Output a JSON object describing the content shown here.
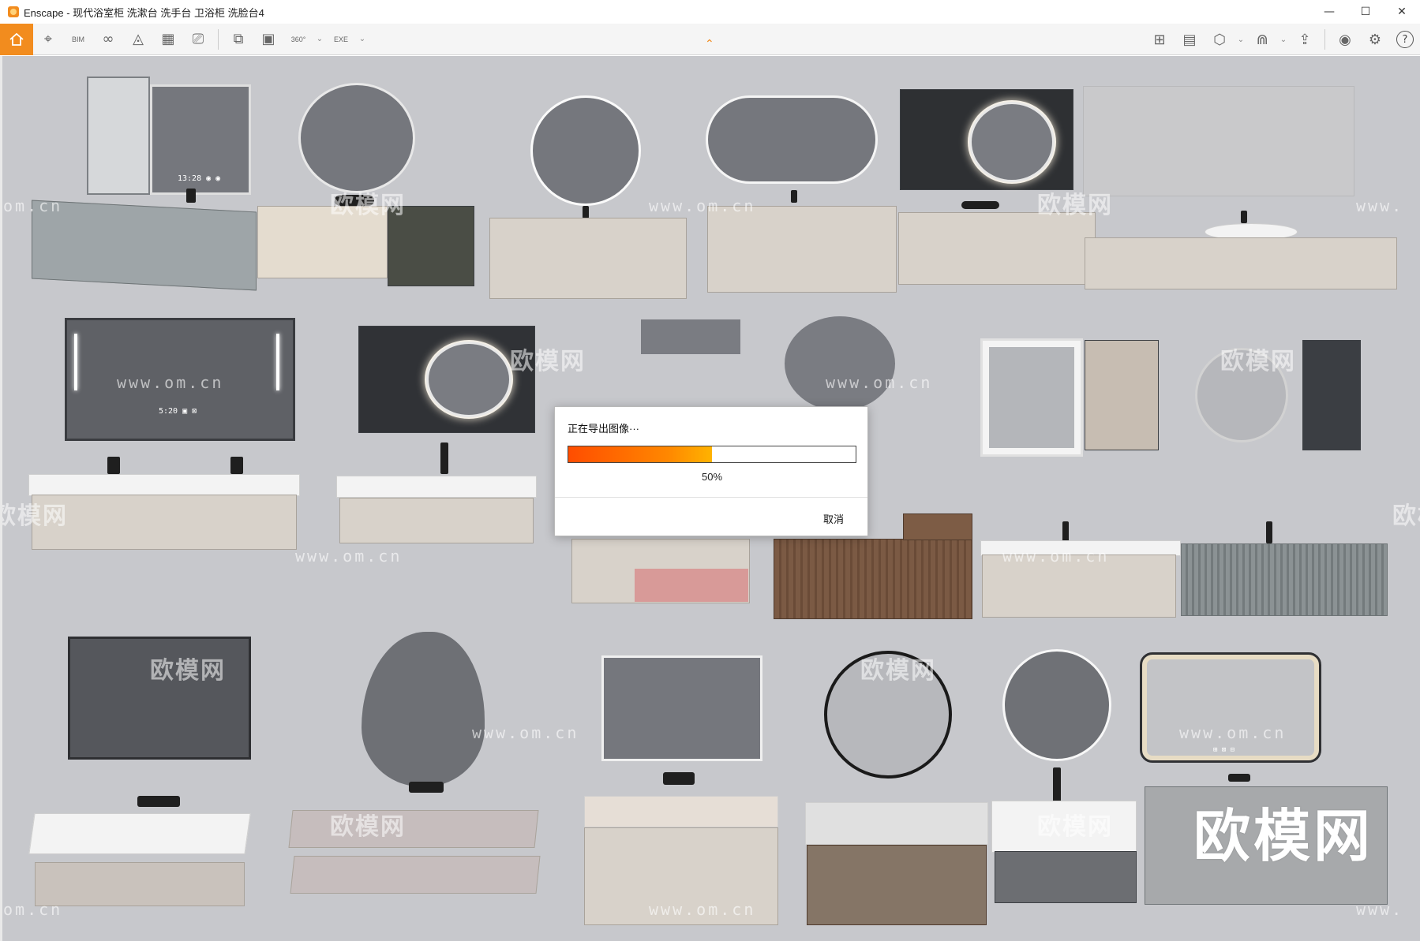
{
  "window": {
    "title": "Enscape - 现代浴室柜 洗漱台 洗手台 卫浴柜 洗脸台4",
    "minimize": "—",
    "maximize": "☐",
    "close": "✕"
  },
  "toolbar": {
    "bim_label": "BIM",
    "pano_label": "360°",
    "exe_label": "EXE",
    "help_label": "?"
  },
  "export_dialog": {
    "title": "正在导出图像···",
    "progress": 0.5,
    "progress_text": "50%",
    "cancel_label": "取消"
  },
  "watermarks": {
    "brand": "欧模网",
    "url": "www.om.cn",
    "url_partial_left": "om.cn",
    "url_partial_right": "www."
  },
  "mirror_clocks": {
    "m1": "13:28 ◉ ◉",
    "m7": "5:20 ▣ ⊠",
    "m11": "⊞ ⊠ ⊟"
  },
  "colors": {
    "accent": "#f28c1e",
    "viewport_bg": "#c7c8cc",
    "progress_start": "#ff4d00",
    "progress_end": "#ffb300"
  }
}
